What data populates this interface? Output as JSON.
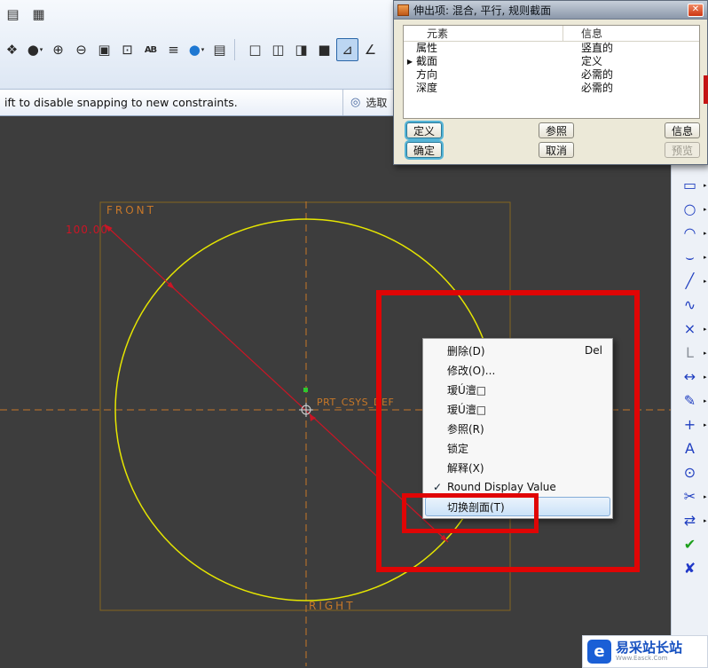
{
  "dialog": {
    "title": "伸出项: 混合, 平行, 规则截面",
    "close_glyph": "✕",
    "columns": {
      "element": "元素",
      "info": "信息"
    },
    "rows": [
      {
        "element": "属性",
        "info": "竖直的",
        "marker": ""
      },
      {
        "element": "截面",
        "info": "定义",
        "marker": "▶"
      },
      {
        "element": "方向",
        "info": "必需的",
        "marker": ""
      },
      {
        "element": "深度",
        "info": "必需的",
        "marker": ""
      }
    ],
    "buttons": {
      "define": "定义",
      "refs": "参照",
      "info": "信息",
      "ok": "确定",
      "cancel": "取消",
      "preview": "预览"
    }
  },
  "prompt_bar": {
    "message": "ift to disable snapping to new constraints.",
    "icon_glyph": "◎",
    "right_label": "选取"
  },
  "canvas": {
    "labels": {
      "front": "FRONT",
      "right": "RIGHT",
      "csys": "PRT_CSYS_DEF",
      "dimension": "100.00"
    },
    "colors": {
      "sketch_yellow": "#e6e600",
      "centerline_orange": "#c87828",
      "dimension_red": "#cc1525",
      "background": "#3d3d3d"
    }
  },
  "context_menu": {
    "items": [
      {
        "id": "delete",
        "label": "删除(D)",
        "shortcut": "Del"
      },
      {
        "id": "modify",
        "label": "修改(O)..."
      },
      {
        "id": "garbled-1",
        "label": "瑷Ú澶□"
      },
      {
        "id": "garbled-2",
        "label": "瑷Ú澶□"
      },
      {
        "id": "references",
        "label": "参照(R)"
      },
      {
        "id": "lock",
        "label": "锁定"
      },
      {
        "id": "explain",
        "label": "解释(X)"
      },
      {
        "id": "round-display-value",
        "label": "Round Display Value",
        "checked": true
      },
      {
        "id": "toggle-section",
        "label": "切换剖面(T)",
        "highlighted": true
      }
    ]
  },
  "top_toolbar": {
    "row1": [
      {
        "name": "sketch-page-icon",
        "glyph": "▤"
      },
      {
        "name": "grid-table-icon",
        "glyph": "▦"
      }
    ],
    "row2": [
      {
        "name": "spin-center-icon",
        "glyph": "❖"
      },
      {
        "name": "render-sphere-icon",
        "glyph": "●",
        "dropdown": true
      },
      {
        "name": "zoom-in-icon",
        "glyph": "⊕"
      },
      {
        "name": "zoom-out-icon",
        "glyph": "⊖"
      },
      {
        "name": "zoom-window-icon",
        "glyph": "▣"
      },
      {
        "name": "refit-icon",
        "glyph": "⊡"
      },
      {
        "name": "annotation-icon",
        "glyph": "AB",
        "small": true
      },
      {
        "name": "layers-icon",
        "glyph": "≡"
      },
      {
        "name": "shaded-view-icon",
        "glyph": "●",
        "color": "#1e78d2",
        "dropdown": true
      },
      {
        "name": "display-style-icon",
        "glyph": "▤"
      },
      {
        "sep": true
      },
      {
        "name": "wireframe-view-icon",
        "glyph": "□"
      },
      {
        "name": "hidden-line-view-icon",
        "glyph": "◫"
      },
      {
        "name": "no-hidden-view-icon",
        "glyph": "◨"
      },
      {
        "name": "shaded-model-icon",
        "glyph": "■"
      },
      {
        "name": "sketch-view-icon",
        "glyph": "⊿",
        "pressed": true
      },
      {
        "name": "angle-snap-icon",
        "glyph": "∠"
      }
    ]
  },
  "right_toolbar": {
    "icons": [
      {
        "name": "rectangle-tool-icon",
        "glyph": "▭",
        "flyout": true
      },
      {
        "name": "circle-tool-icon",
        "glyph": "○",
        "flyout": true
      },
      {
        "name": "arc-tool-icon",
        "glyph": "◠",
        "flyout": true
      },
      {
        "name": "fillet-tool-icon",
        "glyph": "⌣",
        "flyout": true
      },
      {
        "name": "line-tool-icon",
        "glyph": "╱",
        "flyout": true
      },
      {
        "name": "spline-tool-icon",
        "glyph": "∿"
      },
      {
        "name": "point-tool-icon",
        "glyph": "×",
        "flyout": true
      },
      {
        "name": "edge-tool-icon",
        "glyph": "L",
        "color": "#8d939c",
        "flyout": true
      },
      {
        "name": "dimension-tool-icon",
        "glyph": "↔",
        "flyout": true
      },
      {
        "name": "modify-tool-icon",
        "glyph": "✎",
        "flyout": true
      },
      {
        "name": "constraint-tool-icon",
        "glyph": "+",
        "flyout": true
      },
      {
        "name": "text-tool-icon",
        "glyph": "A"
      },
      {
        "name": "palette-tool-icon",
        "glyph": "⊙"
      },
      {
        "name": "trim-tool-icon",
        "glyph": "✂",
        "flyout": true
      },
      {
        "name": "mirror-tool-icon",
        "glyph": "⇄",
        "flyout": true
      },
      {
        "name": "done-button-icon",
        "glyph": "✔",
        "color": "#1da01d"
      },
      {
        "name": "quit-button-icon",
        "glyph": "✘",
        "color": "#2038c8"
      }
    ]
  },
  "watermark": {
    "logo_glyph": "e",
    "brand": "易采站长站",
    "sub": "Www.Easck.Com"
  }
}
